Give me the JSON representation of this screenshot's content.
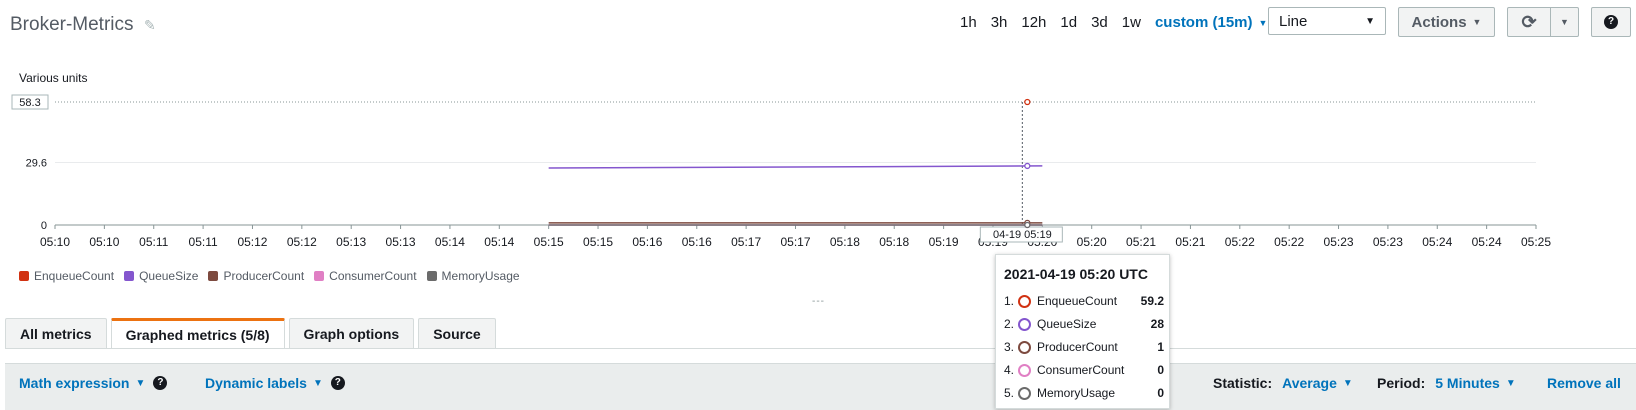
{
  "dashboard": {
    "title": "Broker-Metrics"
  },
  "time_ranges": [
    "1h",
    "3h",
    "12h",
    "1d",
    "3d",
    "1w"
  ],
  "custom_range": "custom (15m)",
  "chart_type_select": "Line",
  "actions_label": "Actions",
  "icons": {
    "edit": "pencil-icon",
    "refresh": "refresh-icon",
    "caret": "caret-down-icon",
    "help": "help-icon"
  },
  "colors": {
    "accent": "#0073bb",
    "tab_highlight": "#ec7211"
  },
  "chart_data": {
    "type": "line",
    "ylabel": "Various units",
    "y_ticks": [
      0,
      29.6,
      58.3
    ],
    "ylim": [
      0,
      58.3
    ],
    "x_ticks": [
      "05:10",
      "05:10",
      "05:11",
      "05:11",
      "05:12",
      "05:12",
      "05:13",
      "05:13",
      "05:14",
      "05:14",
      "05:15",
      "05:15",
      "05:16",
      "05:16",
      "05:17",
      "05:17",
      "05:18",
      "05:18",
      "05:19",
      "05:19",
      "05:20",
      "05:20",
      "05:21",
      "05:21",
      "05:22",
      "05:22",
      "05:23",
      "05:23",
      "05:24",
      "05:24",
      "05:25"
    ],
    "x": [
      "05:15",
      "05:20"
    ],
    "series": [
      {
        "name": "EnqueueCount",
        "color": "#d13212",
        "values": [
          null,
          59.2
        ]
      },
      {
        "name": "QueueSize",
        "color": "#8456ce",
        "values": [
          27,
          28
        ]
      },
      {
        "name": "ProducerCount",
        "color": "#7d4a3f",
        "values": [
          1,
          1
        ]
      },
      {
        "name": "ConsumerCount",
        "color": "#e07fc4",
        "values": [
          0,
          0
        ]
      },
      {
        "name": "MemoryUsage",
        "color": "#6b6b6b",
        "values": [
          0,
          0
        ]
      }
    ],
    "cursor_label": "04-19 05:19",
    "grid": true,
    "legend": "bottom-left"
  },
  "tooltip": {
    "title": "2021-04-19 05:20 UTC",
    "rows": [
      {
        "index": "1.",
        "name": "EnqueueCount",
        "value": "59.2",
        "color": "#d13212"
      },
      {
        "index": "2.",
        "name": "QueueSize",
        "value": "28",
        "color": "#8456ce"
      },
      {
        "index": "3.",
        "name": "ProducerCount",
        "value": "1",
        "color": "#7d4a3f"
      },
      {
        "index": "4.",
        "name": "ConsumerCount",
        "value": "0",
        "color": "#e07fc4"
      },
      {
        "index": "5.",
        "name": "MemoryUsage",
        "value": "0",
        "color": "#6b6b6b"
      }
    ]
  },
  "resize_handle": "---",
  "tabs": [
    "All metrics",
    "Graphed metrics (5/8)",
    "Graph options",
    "Source"
  ],
  "toolbar": {
    "math_expression": "Math expression",
    "dynamic_labels": "Dynamic labels",
    "statistic_label": "Statistic:",
    "statistic_value": "Average",
    "period_label": "Period:",
    "period_value": "5 Minutes",
    "remove_all": "Remove all"
  }
}
